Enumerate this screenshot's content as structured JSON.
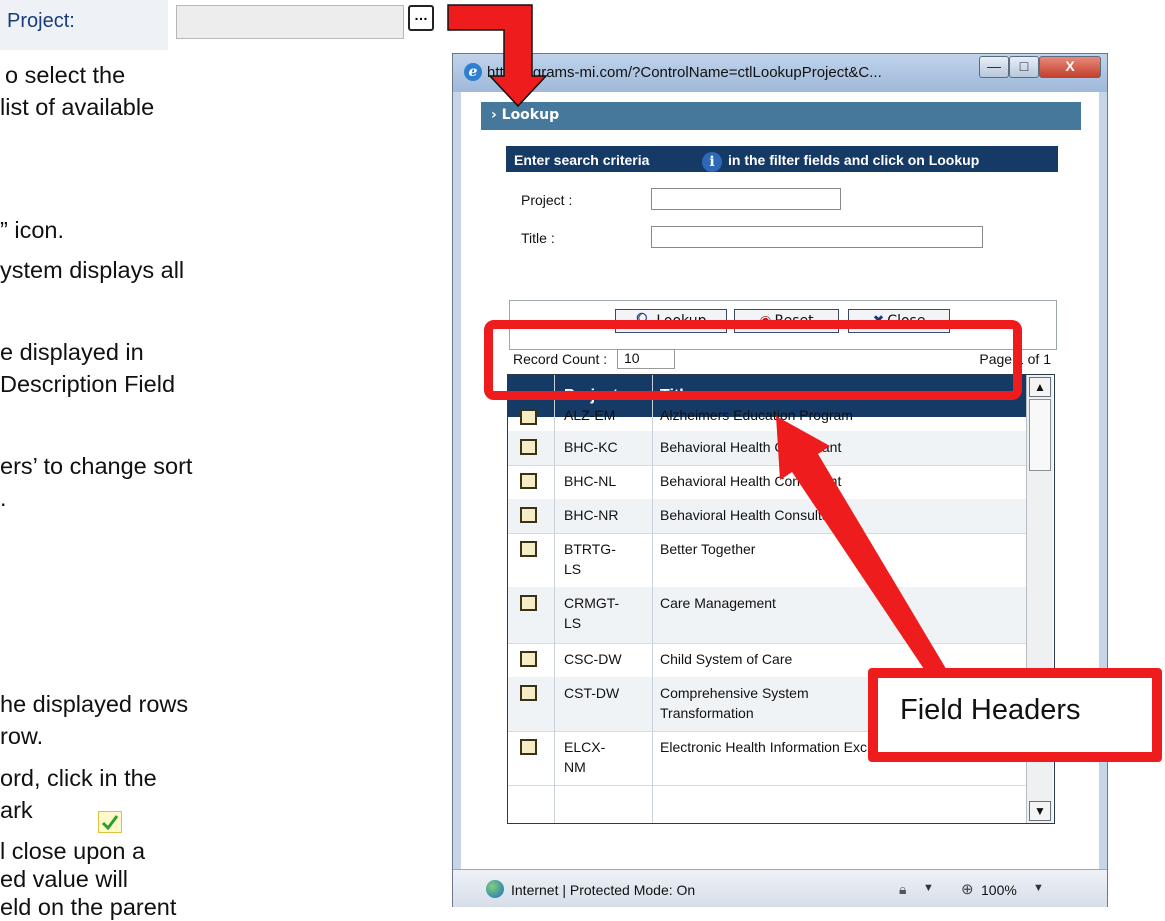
{
  "slide": {
    "project_label": "Project:",
    "ellipsis_label": "…",
    "bullets": [
      "o select the",
      "list of available",
      "” icon.",
      "ystem displays all",
      "e displayed in",
      "Description Field",
      "ers’ to change sort",
      ".",
      "he displayed rows",
      "row.",
      "ord, click in the",
      "ark",
      "l close upon a",
      "ed value will",
      "eld on the parent"
    ]
  },
  "popup": {
    "url": "http://egrams-mi.com/?ControlName=ctlLookupProject&C...",
    "window_buttons": {
      "minimize": "—",
      "maximize": "□",
      "close": "X"
    },
    "lookup_header": "› Lookup",
    "criteria_prefix": "Enter search criteria",
    "criteria_suffix": "in the filter fields and click on Lookup",
    "fields": {
      "project_label": "Project :",
      "project_value": "",
      "title_label": "Title :",
      "title_value": ""
    },
    "buttons": {
      "lookup": "Lookup",
      "reset": "Reset",
      "close": "Close"
    },
    "record_count_label": "Record Count :",
    "record_count_value": "10",
    "page_info": "Page 1 of 1",
    "grid": {
      "headers": {
        "project": "Project",
        "title": "Title"
      },
      "rows": [
        {
          "project": "ALZ-EM",
          "title": "Alzheimers Education Program"
        },
        {
          "project": "BHC-KC",
          "title": "Behavioral Health Consultant"
        },
        {
          "project": "BHC-NL",
          "title": "Behavioral Health Consultant"
        },
        {
          "project": "BHC-NR",
          "title": "Behavioral Health Consultant"
        },
        {
          "project": "BTRTG-LS",
          "title": "Better Together"
        },
        {
          "project": "CRMGT-LS",
          "title": "Care Management"
        },
        {
          "project": "CSC-DW",
          "title": "Child System of Care"
        },
        {
          "project": "CST-DW",
          "title": "Comprehensive System Transformation"
        },
        {
          "project": "ELCX-NM",
          "title": "Electronic Health Information Exchange"
        }
      ]
    },
    "status": {
      "zone": "Internet | Protected Mode: On",
      "zoom": "100%"
    }
  },
  "callout": {
    "label": "Field Headers"
  },
  "colors": {
    "annotation_red": "#ee1c1c",
    "grid_header": "#163a66",
    "lookup_bar": "#45789a"
  }
}
